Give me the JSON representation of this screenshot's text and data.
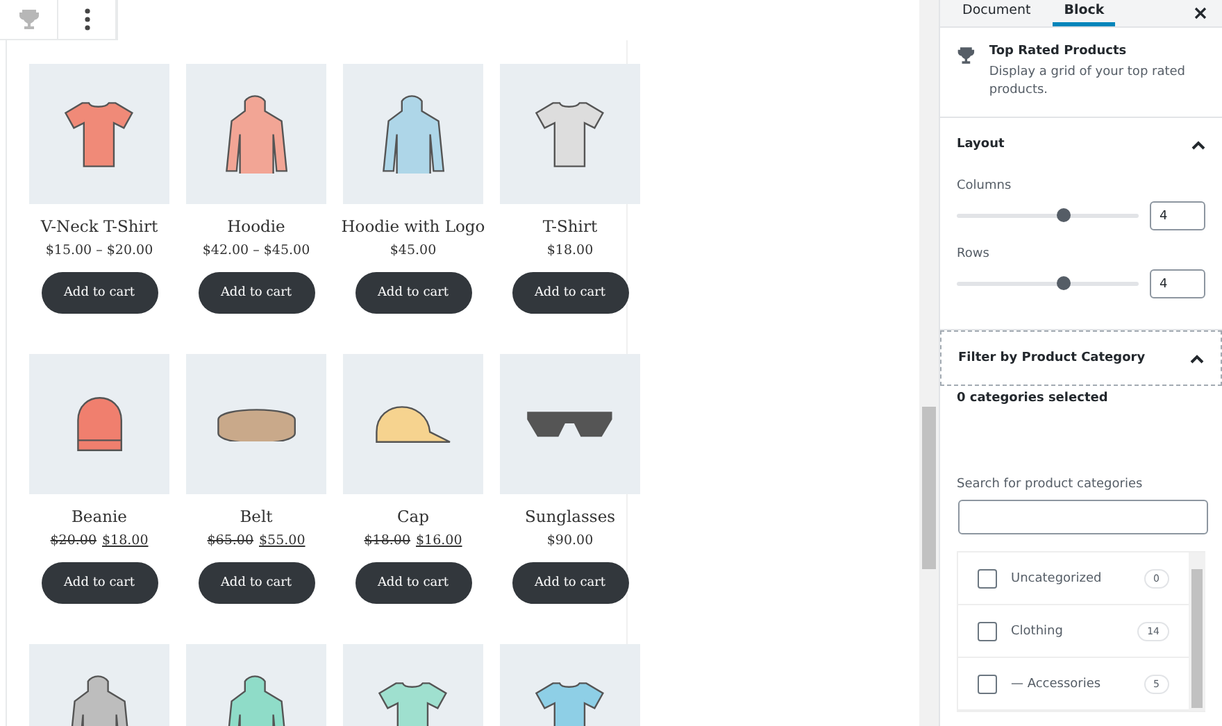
{
  "block_toolbar": {
    "buttons": [
      {
        "kind": "trophy"
      },
      {
        "kind": "more"
      }
    ]
  },
  "products": [
    {
      "kind": "tshirt",
      "color": "#f08a78",
      "name": "V-Neck T-Shirt",
      "price": "$15.00 – $20.00",
      "button": "Add to cart"
    },
    {
      "kind": "hoodie",
      "color": "#f2a595",
      "name": "Hoodie",
      "price": "$42.00 – $45.00",
      "button": "Add to cart"
    },
    {
      "kind": "hoodie",
      "color": "#aed6e8",
      "name": "Hoodie with Logo",
      "price": "$45.00",
      "button": "Add to cart"
    },
    {
      "kind": "tshirt",
      "color": "#dddddd",
      "name": "T-Shirt",
      "price": "$18.00",
      "button": "Add to cart"
    },
    {
      "kind": "beanie",
      "color": "#f07f6e",
      "name": "Beanie",
      "regular_price": "$20.00",
      "sale_price": "$18.00",
      "button": "Add to cart"
    },
    {
      "kind": "belt",
      "color": "#c9a98a",
      "name": "Belt",
      "regular_price": "$65.00",
      "sale_price": "$55.00",
      "button": "Add to cart"
    },
    {
      "kind": "cap",
      "color": "#f6d38f",
      "name": "Cap",
      "regular_price": "$18.00",
      "sale_price": "$16.00",
      "button": "Add to cart"
    },
    {
      "kind": "sunglasses",
      "color": "#555555",
      "name": "Sunglasses",
      "price": "$90.00",
      "button": "Add to cart"
    },
    {
      "kind": "hoodie",
      "color": "#bdbdbd"
    },
    {
      "kind": "hoodie",
      "color": "#8fdcc8"
    },
    {
      "kind": "tshirt",
      "color": "#9fe0cf"
    },
    {
      "kind": "tshirt",
      "color": "#8ecfe6"
    }
  ],
  "sidebar": {
    "tabs": [
      {
        "label": "Document",
        "selected": false
      },
      {
        "label": "Block",
        "selected": true
      }
    ],
    "block": {
      "title": "Top Rated Products",
      "description": "Display a grid of your top rated products."
    },
    "layout": {
      "title": "Layout",
      "expanded": true,
      "controls": [
        {
          "label": "Columns",
          "level": 0.59,
          "value": "4"
        },
        {
          "label": "Rows",
          "level": 0.59,
          "value": "4"
        }
      ]
    },
    "filter": {
      "title": "Filter by Product Category",
      "expanded": true,
      "summary": "0 categories selected",
      "search_label": "Search for product categories",
      "categories": [
        {
          "label": "Uncategorized",
          "count": "0",
          "checked": false
        },
        {
          "label": "Clothing",
          "count": "14",
          "checked": false
        },
        {
          "label": "— Accessories",
          "count": "5",
          "checked": false
        }
      ]
    }
  }
}
